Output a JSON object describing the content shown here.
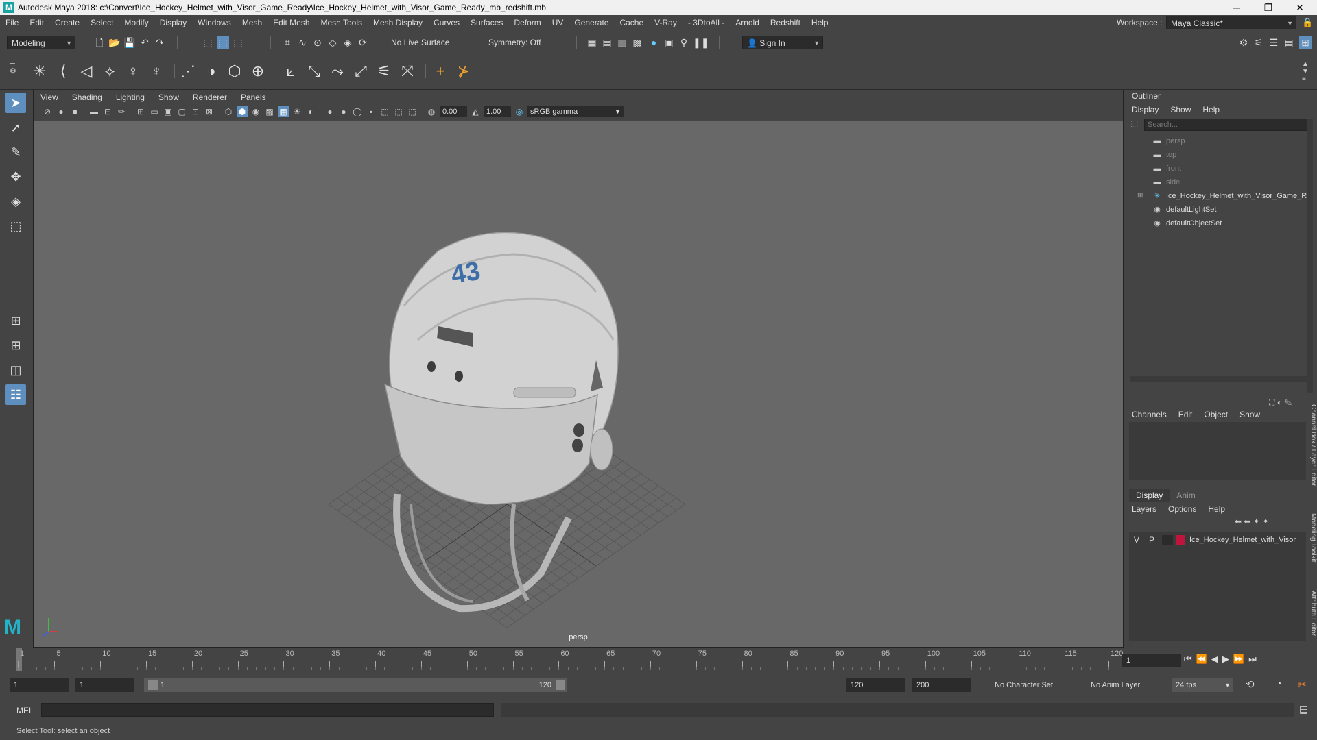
{
  "window": {
    "title": "Autodesk Maya 2018: c:\\Convert\\Ice_Hockey_Helmet_with_Visor_Game_Ready\\Ice_Hockey_Helmet_with_Visor_Game_Ready_mb_redshift.mb",
    "logo": "M",
    "minimize": "─",
    "maximize": "❐",
    "close": "✕"
  },
  "menubar": {
    "items": [
      "File",
      "Edit",
      "Create",
      "Select",
      "Modify",
      "Display",
      "Windows",
      "Mesh",
      "Edit Mesh",
      "Mesh Tools",
      "Mesh Display",
      "Curves",
      "Surfaces",
      "Deform",
      "UV",
      "Generate",
      "Cache",
      "V-Ray",
      "- 3DtoAll -",
      "Arnold",
      "Redshift",
      "Help"
    ],
    "workspace_label": "Workspace :",
    "workspace_value": "Maya Classic*"
  },
  "statusline": {
    "mode": "Modeling",
    "live_surface": "No Live Surface",
    "symmetry": "Symmetry: Off",
    "sign_in": "Sign In"
  },
  "viewport": {
    "menu": [
      "View",
      "Shading",
      "Lighting",
      "Show",
      "Renderer",
      "Panels"
    ],
    "exposure": "0.00",
    "gamma": "1.00",
    "color_space": "sRGB gamma",
    "camera": "persp",
    "helmet_number": "43",
    "axis_colors": {
      "x": "#d04040",
      "y": "#40c040",
      "z": "#4060e0"
    }
  },
  "outliner": {
    "title": "Outliner",
    "menu": [
      "Display",
      "Show",
      "Help"
    ],
    "search_placeholder": "Search...",
    "items": [
      {
        "label": "persp",
        "icon": "camera-icon",
        "dim": true
      },
      {
        "label": "top",
        "icon": "camera-icon",
        "dim": true
      },
      {
        "label": "front",
        "icon": "camera-icon",
        "dim": true
      },
      {
        "label": "side",
        "icon": "camera-icon",
        "dim": true
      },
      {
        "label": "Ice_Hockey_Helmet_with_Visor_Game_Re",
        "icon": "transform-icon",
        "dim": false,
        "expandable": true
      },
      {
        "label": "defaultLightSet",
        "icon": "set-icon",
        "dim": false
      },
      {
        "label": "defaultObjectSet",
        "icon": "set-icon",
        "dim": false
      }
    ]
  },
  "channel_box": {
    "menu": [
      "Channels",
      "Edit",
      "Object",
      "Show"
    ]
  },
  "layer_editor": {
    "tabs": [
      "Display",
      "Anim"
    ],
    "menu": [
      "Layers",
      "Options",
      "Help"
    ],
    "layer": {
      "v": "V",
      "p": "P",
      "name": "Ice_Hockey_Helmet_with_Visor",
      "color": "#c0143c"
    }
  },
  "side_tabs": [
    "Channel Box / Layer Editor",
    "Modeling Toolkit",
    "Attribute Editor"
  ],
  "timeslider": {
    "ticks": [
      1,
      5,
      10,
      15,
      20,
      25,
      30,
      35,
      40,
      45,
      50,
      55,
      60,
      65,
      70,
      75,
      80,
      85,
      90,
      95,
      100,
      105,
      110,
      115,
      120
    ],
    "current_frame": "1"
  },
  "range": {
    "start": "1",
    "playback_start": "1",
    "slider_left": "1",
    "slider_right": "120",
    "playback_end": "120",
    "end": "200",
    "character_set": "No Character Set",
    "anim_layer": "No Anim Layer",
    "fps": "24 fps"
  },
  "cmdline": {
    "label": "MEL"
  },
  "helpline": {
    "text": "Select Tool: select an object"
  }
}
